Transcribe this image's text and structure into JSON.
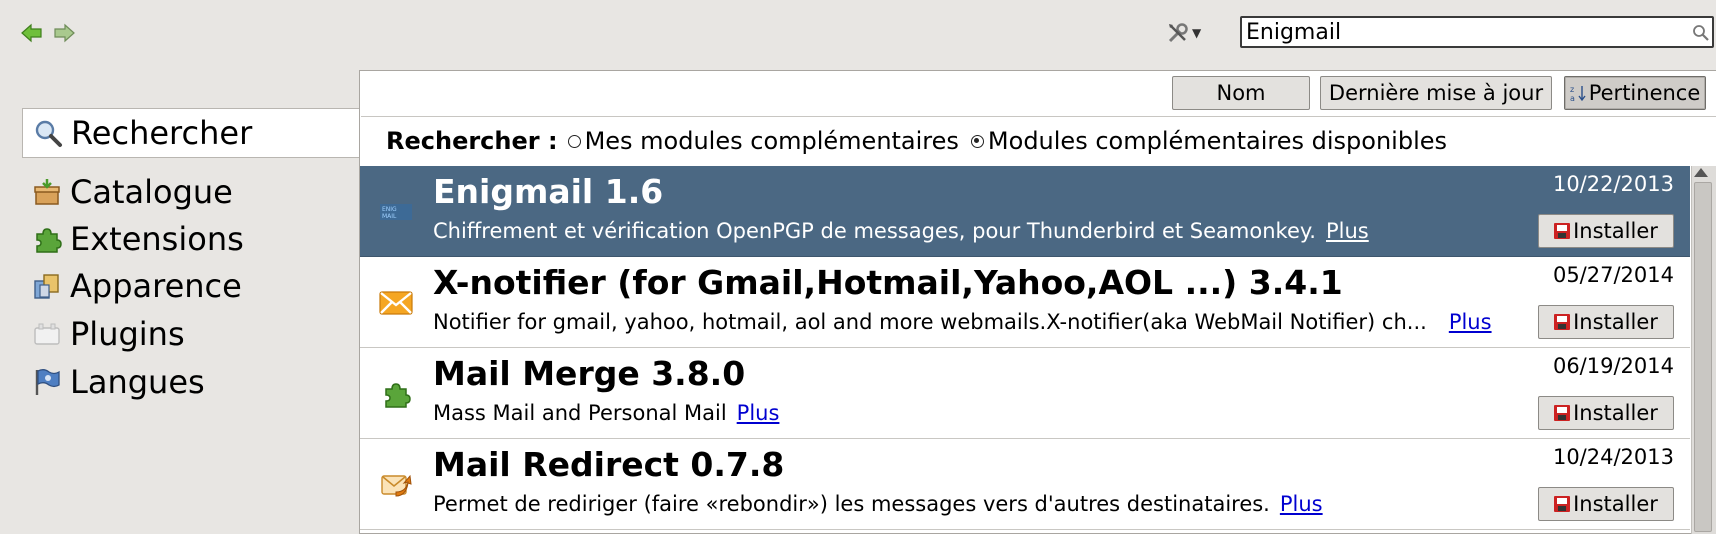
{
  "toolbar": {
    "back_icon": "back-arrow-icon",
    "forward_icon": "forward-arrow-icon",
    "tools_icon": "tools-icon",
    "search_value": "Enigmail"
  },
  "sidebar": {
    "items": [
      {
        "label": "Rechercher",
        "icon": "search-icon",
        "selected": true
      },
      {
        "label": "Catalogue",
        "icon": "catalog-icon"
      },
      {
        "label": "Extensions",
        "icon": "extensions-icon"
      },
      {
        "label": "Apparence",
        "icon": "appearance-icon"
      },
      {
        "label": "Plugins",
        "icon": "plugins-icon"
      },
      {
        "label": "Langues",
        "icon": "languages-icon"
      }
    ]
  },
  "sort": {
    "name_label": "Nom",
    "updated_label": "Dernière mise à jour",
    "relevance_label": "Pertinence",
    "active": "relevance"
  },
  "scope": {
    "label": "Rechercher :",
    "my_addons": "Mes modules complémentaires",
    "available_addons": "Modules complémentaires disponibles",
    "selected": "available_addons"
  },
  "results": [
    {
      "name": "Enigmail 1.6",
      "description": "Chiffrement et vérification OpenPGP de messages, pour Thunderbird et Seamonkey.",
      "more": "Plus",
      "date": "10/22/2013",
      "install": "Installer",
      "selected": true,
      "icon": "enigmail-icon"
    },
    {
      "name": "X-notifier (for Gmail,Hotmail,Yahoo,AOL ...) 3.4.1",
      "description": "Notifier for gmail, yahoo, hotmail, aol and more webmails.X-notifier(aka WebMail Notifier) ch...",
      "more": "Plus",
      "date": "05/27/2014",
      "install": "Installer",
      "icon": "envelope-icon"
    },
    {
      "name": "Mail Merge 3.8.0",
      "description": "Mass Mail and Personal Mail",
      "more": "Plus",
      "date": "06/19/2014",
      "install": "Installer",
      "icon": "puzzle-icon"
    },
    {
      "name": "Mail Redirect 0.7.8",
      "description": "Permet de rediriger (faire «rebondir») les messages vers d'autres destinataires.",
      "more": "Plus",
      "date": "10/24/2013",
      "install": "Installer",
      "icon": "redirect-mail-icon"
    }
  ],
  "colors": {
    "selected_row": "#4b6883",
    "link": "#0000d0",
    "window_bg": "#e8e6e3"
  }
}
